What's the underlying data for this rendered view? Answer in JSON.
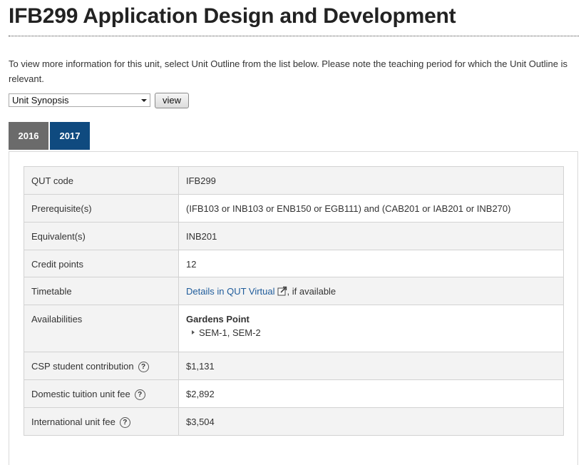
{
  "page": {
    "title": "IFB299 Application Design and Development",
    "intro": "To view more information for this unit, select Unit Outline from the list below. Please note the teaching period for which the Unit Outline is relevant."
  },
  "selector": {
    "selected": "Unit Synopsis",
    "button_label": "view"
  },
  "tabs": [
    {
      "label": "2016",
      "active": false
    },
    {
      "label": "2017",
      "active": true
    }
  ],
  "unit_info": {
    "qut_code": {
      "label": "QUT code",
      "value": "IFB299"
    },
    "prerequisites": {
      "label": "Prerequisite(s)",
      "value": "(IFB103 or INB103 or ENB150 or EGB111) and (CAB201 or IAB201 or INB270)"
    },
    "equivalents": {
      "label": "Equivalent(s)",
      "value": "INB201"
    },
    "credit_points": {
      "label": "Credit points",
      "value": "12"
    },
    "timetable": {
      "label": "Timetable",
      "link_text": "Details in QUT Virtual",
      "suffix": ", if available"
    },
    "availabilities": {
      "label": "Availabilities",
      "campus": "Gardens Point",
      "periods": "SEM-1, SEM-2"
    },
    "csp": {
      "label": "CSP student contribution",
      "value": "$1,131"
    },
    "domestic_fee": {
      "label": "Domestic tuition unit fee",
      "value": "$2,892"
    },
    "international_fee": {
      "label": "International unit fee",
      "value": "$3,504"
    }
  },
  "help_glyph": "?",
  "colors": {
    "tab_active": "#0f4a7f",
    "tab_inactive": "#6b6b6b",
    "link": "#1f5c9b",
    "row_shade": "#f3f3f3"
  }
}
